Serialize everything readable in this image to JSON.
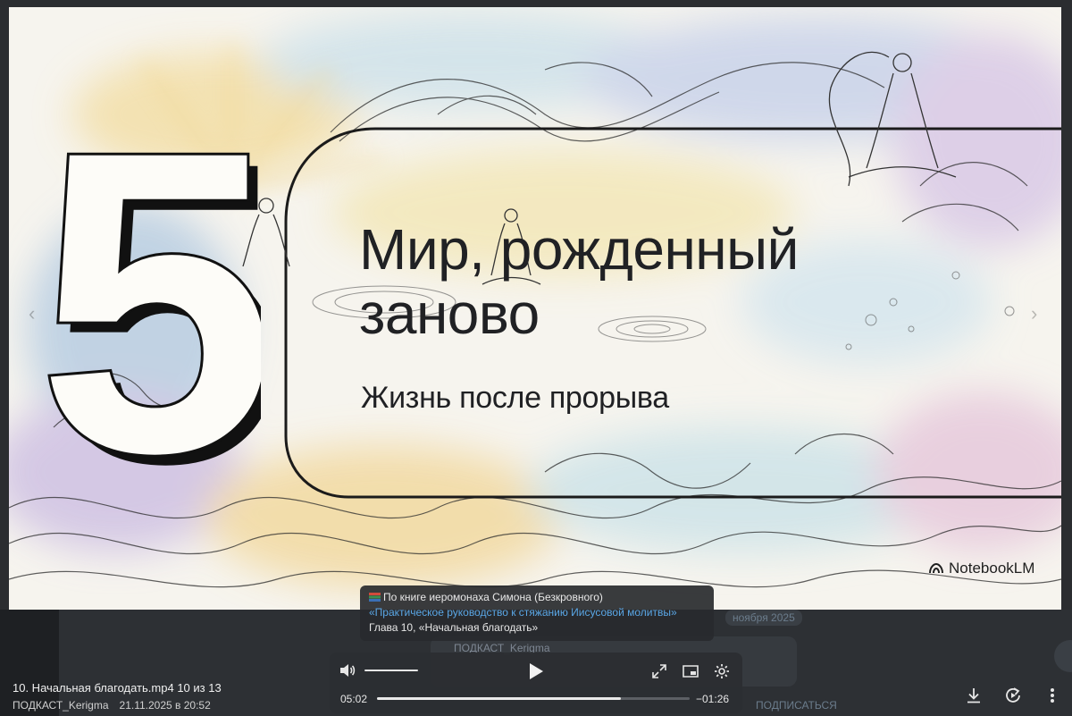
{
  "slide": {
    "number": "5",
    "title": "Мир, рожденный заново",
    "subtitle": "Жизнь после прорыва",
    "brand": "NotebookLM"
  },
  "caption": {
    "line1": "По книге иеромонаха Симона (Безкровного)",
    "line2": "«Практическое руководство к стяжанию Иисусовой молитвы»",
    "line3": "Глава 10, «Начальная благодать»",
    "icon": "books-icon"
  },
  "background": {
    "date_badge": "ноября 2025",
    "sender": "ПОДКАСТ_Kerigma",
    "action": "ПОДПИСАТЬСЯ"
  },
  "player": {
    "current_time": "05:02",
    "remaining_time": "−01:26",
    "progress": 0.78,
    "volume": 1.0,
    "icons": [
      "volume-icon",
      "play-icon",
      "fullscreen-icon",
      "picture-in-picture-icon",
      "settings-icon"
    ]
  },
  "media": {
    "filename": "10. Начальная благодать.mp4",
    "position": "10 из 13",
    "channel": "ПОДКАСТ_Kerigma",
    "date": "21.11.2025 в 20:52"
  },
  "actions": {
    "icons": [
      "download-icon",
      "forward-icon",
      "more-icon"
    ]
  },
  "colors": {
    "accent_link": "#5aa7e6",
    "panel_bg": "#2d3034",
    "title_text": "#202124"
  }
}
